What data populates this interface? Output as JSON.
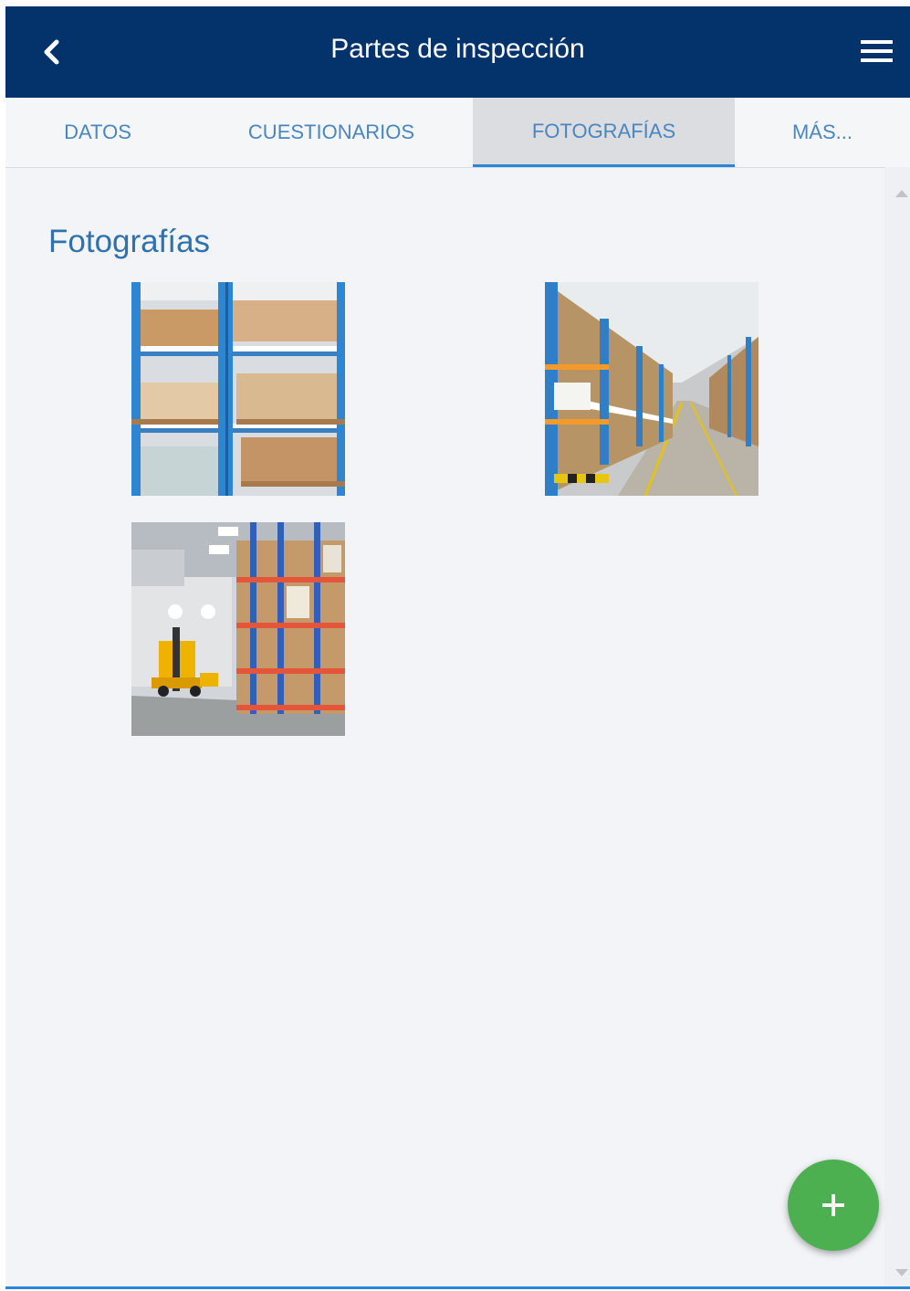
{
  "header": {
    "title": "Partes de inspección",
    "back_icon": "chevron-left-icon",
    "menu_icon": "hamburger-menu-icon"
  },
  "tabs": [
    {
      "label": "DATOS",
      "active": false
    },
    {
      "label": "CUESTIONARIOS",
      "active": false
    },
    {
      "label": "FOTOGRAFÍAS",
      "active": true
    },
    {
      "label": "MÁS...",
      "active": false
    }
  ],
  "main": {
    "section_title": "Fotografías",
    "photos": [
      {
        "subject": "warehouse shelves with boxes"
      },
      {
        "subject": "warehouse aisle"
      },
      {
        "subject": "warehouse racks with forklift"
      }
    ]
  },
  "fab": {
    "icon": "plus-icon"
  },
  "colors": {
    "header_bg": "#04326a",
    "tab_text": "#4a86c0",
    "accent": "#2a86d8",
    "fab": "#4caf50",
    "page_bg": "#f2f4f8"
  }
}
